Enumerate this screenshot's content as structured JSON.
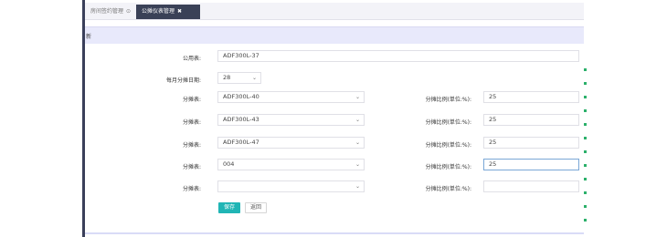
{
  "tabs": [
    {
      "label": "房间签约管理",
      "close": "⊙"
    },
    {
      "label": "公摊仪表管理",
      "close": "✖"
    }
  ],
  "page_header": "新",
  "form": {
    "meter_label": "公用表:",
    "meter_value": "ADF300L-37",
    "day_label": "每月分摊日期:",
    "day_value": "28",
    "rows": [
      {
        "label": "分摊表:",
        "value": "ADF300L-40",
        "ratio_label": "分摊比例(单位:%):",
        "ratio": "25"
      },
      {
        "label": "分摊表:",
        "value": "ADF300L-43",
        "ratio_label": "分摊比例(单位:%):",
        "ratio": "25"
      },
      {
        "label": "分摊表:",
        "value": "ADF300L-47",
        "ratio_label": "分摊比例(单位:%):",
        "ratio": "25"
      },
      {
        "label": "分摊表:",
        "value": "004",
        "ratio_label": "分摊比例(单位:%):",
        "ratio": "25"
      },
      {
        "label": "分摊表:",
        "value": "",
        "ratio_label": "分摊比例(单位:%):",
        "ratio": ""
      }
    ],
    "save_label": "保存",
    "back_label": "返回"
  },
  "icons": {
    "select_caret": "chevron-down-icon"
  },
  "colors": {
    "save": "#20b5b5",
    "header": "#e8e9fb",
    "tab_active": "#3a4157"
  }
}
